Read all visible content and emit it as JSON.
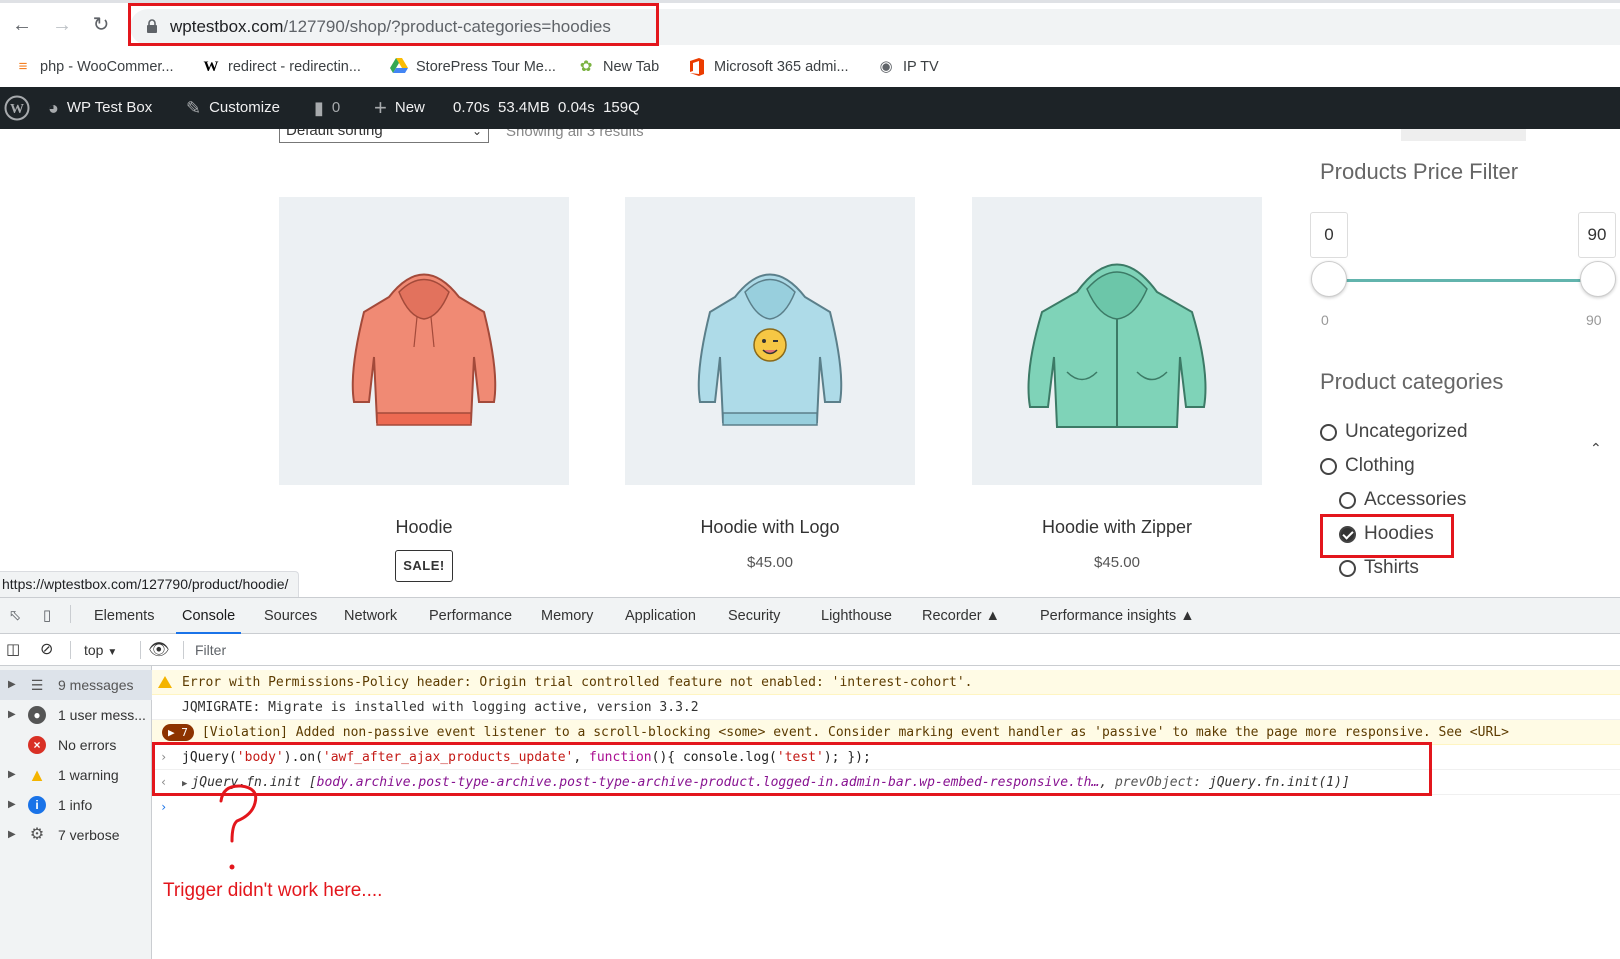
{
  "browser": {
    "url_host": "wptestbox.com",
    "url_path": "/127790/shop/?product-categories=hoodies",
    "bookmarks": [
      {
        "label": "php - WooCommer...",
        "icon": "stackoverflow-icon"
      },
      {
        "label": "redirect - redirectin...",
        "icon": "wikipedia-icon"
      },
      {
        "label": "StorePress Tour Me...",
        "icon": "google-drive-icon"
      },
      {
        "label": "New Tab",
        "icon": "leaf-icon"
      },
      {
        "label": "Microsoft 365 admi...",
        "icon": "office-icon"
      },
      {
        "label": "IP TV",
        "icon": "globe-icon"
      }
    ]
  },
  "admin_bar": {
    "site_name": "WP Test Box",
    "customize": "Customize",
    "comments": "0",
    "new": "New",
    "stats": "0.70s  53.4MB  0.04s  159Q"
  },
  "shop": {
    "sort_label": "Default sorting",
    "result_count": "Showing all 3 results",
    "products": [
      {
        "name": "Hoodie",
        "badge": "SALE!",
        "price": "",
        "color": "#f08a74"
      },
      {
        "name": "Hoodie with Logo",
        "badge": "",
        "price": "$45.00",
        "color": "#aedbe8"
      },
      {
        "name": "Hoodie with Zipper",
        "badge": "",
        "price": "$45.00",
        "color": "#7fd3b8"
      }
    ],
    "price_filter": {
      "title": "Products Price Filter",
      "min_input": "0",
      "max_input": "90",
      "min_label": "0",
      "max_label": "90"
    },
    "categories": {
      "title": "Product categories",
      "items": [
        {
          "label": "Uncategorized",
          "checked": false
        },
        {
          "label": "Clothing",
          "checked": false
        },
        {
          "label": "Accessories",
          "checked": false
        },
        {
          "label": "Hoodies",
          "checked": true
        },
        {
          "label": "Tshirts",
          "checked": false
        }
      ]
    },
    "status_url": "https://wptestbox.com/127790/product/hoodie/"
  },
  "devtools": {
    "tabs": [
      "Elements",
      "Console",
      "Sources",
      "Network",
      "Performance",
      "Memory",
      "Application",
      "Security",
      "Lighthouse",
      "Recorder",
      "Performance insights"
    ],
    "active_tab": "Console",
    "context": "top",
    "filter_placeholder": "Filter",
    "sidebar": [
      {
        "label": "9 messages",
        "icon": "list-icon"
      },
      {
        "label": "1 user mess...",
        "icon": "user-icon"
      },
      {
        "label": "No errors",
        "icon": "error-icon"
      },
      {
        "label": "1 warning",
        "icon": "warning-icon"
      },
      {
        "label": "1 info",
        "icon": "info-icon"
      },
      {
        "label": "7 verbose",
        "icon": "bug-icon"
      }
    ],
    "console": {
      "warning": "Error with Permissions-Policy header: Origin trial controlled feature not enabled: 'interest-cohort'.",
      "jqmigrate": "JQMIGRATE: Migrate is installed with logging active, version 3.3.2",
      "violation_count": "7",
      "violation": "[Violation] Added non-passive event listener to a scroll-blocking <some> event. Consider marking event handler as 'passive' to make the page more responsive. See <URL>",
      "input_a": "jQuery(",
      "input_b": "'body'",
      "input_c": ").on(",
      "input_d": "'awf_after_ajax_products_update'",
      "input_e": ", ",
      "input_f": "function",
      "input_g": "(){ console.log(",
      "input_h": "'test'",
      "input_i": "); });",
      "output_a": "jQuery.fn.init [",
      "output_b": "body.archive.post-type-archive.post-type-archive-product.logged-in.admin-bar.wp-embed-responsive.th…",
      "output_c": ", ",
      "output_d": "prevObject:",
      "output_e": " jQuery.fn.init(1)]"
    }
  },
  "annotation": {
    "mark": "?",
    "text": "Trigger didn't work here...."
  },
  "colors": {
    "annotation_red": "#e3161c",
    "admin_bar": "#1d2327",
    "slider": "#62b4ad"
  }
}
